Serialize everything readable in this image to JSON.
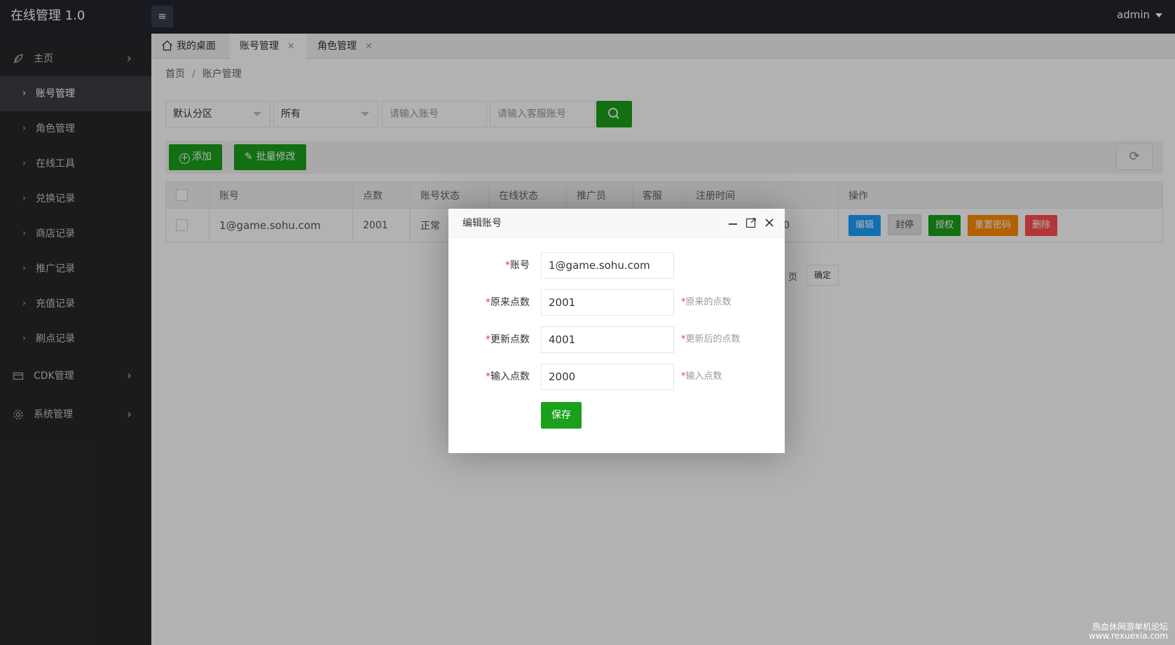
{
  "app": {
    "title": "在线管理 1.0",
    "menu_icon": "≡",
    "user": "admin"
  },
  "sidebar": {
    "home": "主页",
    "sub_items": [
      {
        "label": "账号管理",
        "active": true
      },
      {
        "label": "角色管理"
      },
      {
        "label": "在线工具"
      },
      {
        "label": "兑换记录"
      },
      {
        "label": "商店记录"
      },
      {
        "label": "推广记录"
      },
      {
        "label": "充值记录"
      },
      {
        "label": "刷点记录"
      }
    ],
    "cdk": "CDK管理",
    "system": "系统管理"
  },
  "tabs": [
    {
      "label": "我的桌面"
    },
    {
      "label": "账号管理",
      "active": true
    },
    {
      "label": "角色管理"
    }
  ],
  "tab_close": "✕",
  "breadcrumb": {
    "home": "首页",
    "sep": "/",
    "current": "账户管理"
  },
  "filters": {
    "zone": "默认分区",
    "status": "所有",
    "account_placeholder": "请输入账号",
    "cs_placeholder": "请输入客服账号"
  },
  "toolbar": {
    "add": "添加",
    "batch": "批量修改"
  },
  "table": {
    "headers": [
      "账号",
      "点数",
      "账号状态",
      "在线状态",
      "推广员",
      "客服",
      "注册时间",
      "操作"
    ],
    "row": {
      "account": "1@game.sohu.com",
      "points": "2001",
      "status": "正常",
      "reg_time_tail": "40"
    },
    "actions": [
      "编辑",
      "封停",
      "授权",
      "重置密码",
      "删除"
    ]
  },
  "pager": {
    "page_unit": "页",
    "confirm": "确定"
  },
  "modal": {
    "title": "编辑账号",
    "fields": [
      {
        "label": "账号",
        "value": "1@game.sohu.com",
        "hint": ""
      },
      {
        "label": "原来点数",
        "value": "2001",
        "hint": "原来的点数"
      },
      {
        "label": "更新点数",
        "value": "4001",
        "hint": "更新后的点数"
      },
      {
        "label": "输入点数",
        "value": "2000",
        "hint": "输入点数"
      }
    ],
    "required_mark": "*",
    "save": "保存"
  },
  "watermark": {
    "line1": "热血休网游单机论坛",
    "line2": "www.rexuexia.com"
  },
  "colors": {
    "green": "#1aa01a",
    "blue": "#1e9fff",
    "orange": "#ff8c00",
    "red": "#ff5050",
    "header": "#23262e",
    "sidebar": "#28282b"
  }
}
